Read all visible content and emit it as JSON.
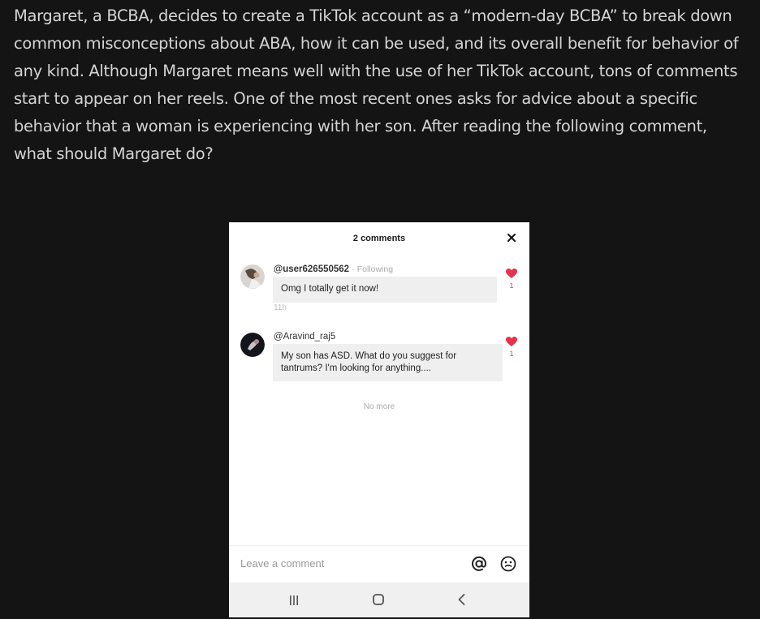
{
  "question": {
    "text": "Margaret, a BCBA, decides to create a TikTok account as a “modern-day BCBA” to break down common misconceptions about ABA, how it can be used, and its overall benefit for behavior of any kind. Although Margaret means well with the use of her TikTok account, tons of comments start to appear on her reels. One of the most recent ones asks for advice about a specific behavior that a woman is experiencing with her son. After reading the following comment, what should Margaret do?"
  },
  "panel": {
    "title": "2 comments",
    "no_more": "No more"
  },
  "comments": [
    {
      "username": "@user626550562",
      "status": "· Following",
      "text": "Omg I totally get it now!",
      "time": "11h",
      "likes": "1"
    },
    {
      "username": "@Aravind_raj5",
      "text": "My son has ASD. What do you suggest for tantrums? I'm looking for anything....",
      "likes": "1"
    }
  ],
  "input": {
    "placeholder": "Leave a comment"
  },
  "icons": {
    "close": "close-icon",
    "heart": "heart-icon",
    "mention": "at-icon",
    "emoji": "emoji-icon",
    "recent_apps": "recent-apps-icon",
    "home": "home-icon",
    "back": "back-icon"
  },
  "colors": {
    "background": "#141414",
    "text": "#d4d4d4",
    "heart": "#e8334f"
  }
}
